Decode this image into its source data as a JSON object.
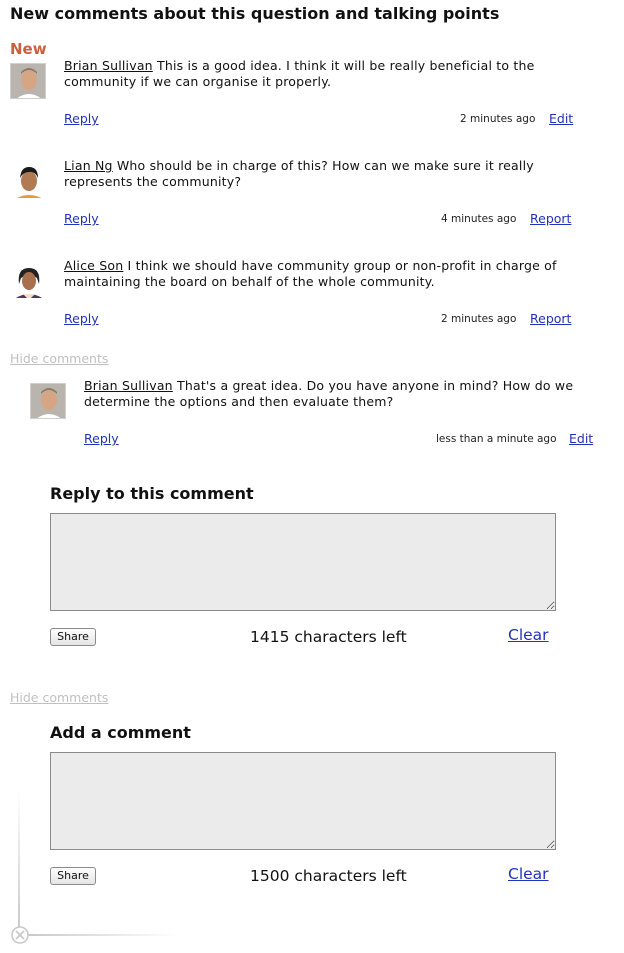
{
  "header": {
    "title": "New comments about this question and talking points",
    "new_label": "New"
  },
  "comments": [
    {
      "author": "Brian Sullivan",
      "text": "This is a good idea. I think it will be really beneficial to the community if we can organise it properly.",
      "reply_label": "Reply",
      "time": "2 minutes ago",
      "action_label": "Edit"
    },
    {
      "author": "Lian Ng",
      "text": "Who should be in charge of this? How can we make sure it really represents the community?",
      "reply_label": "Reply",
      "time": "4 minutes ago",
      "action_label": "Report"
    },
    {
      "author": "Alice Son",
      "text": "I think we should have community group or non-profit in charge of maintaining the board on behalf of the whole community.",
      "reply_label": "Reply",
      "time": "2 minutes ago",
      "action_label": "Report"
    }
  ],
  "hide_comments_label": "Hide comments",
  "reply_thread": {
    "author": "Brian Sullivan",
    "text": "That's a great idea. Do you have anyone in mind? How do we determine the options and then evaluate them?",
    "reply_label": "Reply",
    "time": "less than a minute ago",
    "action_label": "Edit"
  },
  "reply_form": {
    "title": "Reply to this comment",
    "value": "",
    "share_label": "Share",
    "chars_left": "1415 characters left",
    "clear_label": "Clear"
  },
  "hide_comments_label_2": "Hide comments",
  "add_form": {
    "title": "Add a comment",
    "value": "",
    "share_label": "Share",
    "chars_left": "1500 characters left",
    "clear_label": "Clear"
  },
  "colors": {
    "accent_new": "#c8623e",
    "link": "#2233bb",
    "muted_link": "#c0c0c0",
    "textarea_bg": "#ebebeb"
  },
  "icons": [
    "avatar-icon",
    "close-circle-icon"
  ]
}
